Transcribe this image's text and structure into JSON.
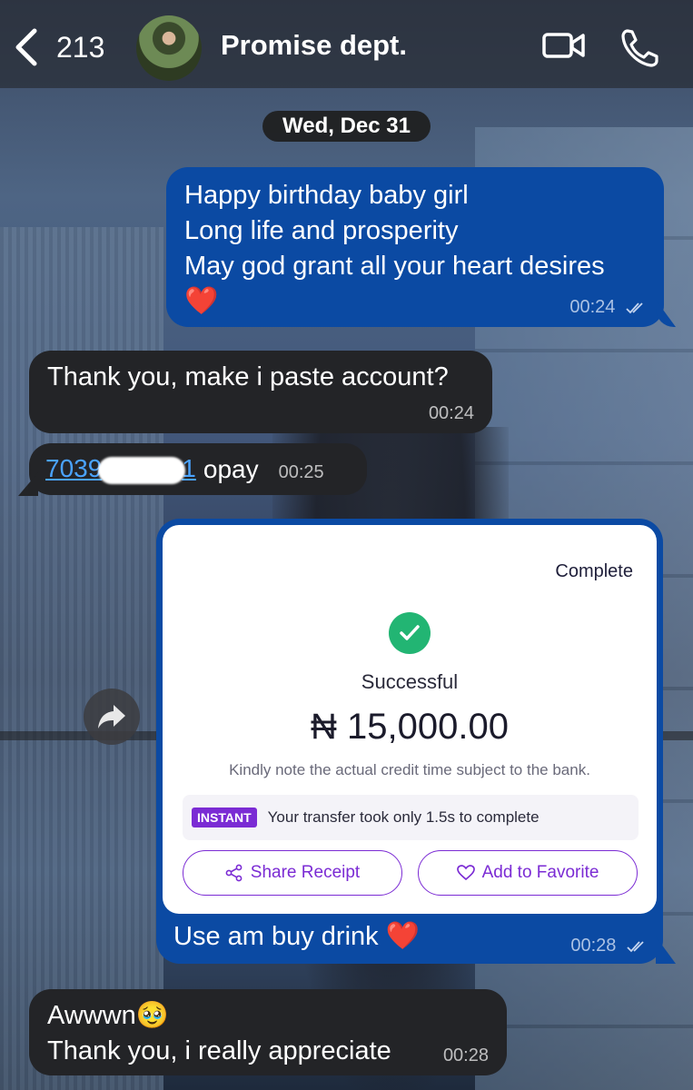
{
  "header": {
    "back_count": "213",
    "contact_name": "Promise dept."
  },
  "date_separator": "Wed, Dec 31",
  "messages": [
    {
      "direction": "outgoing",
      "lines": [
        "Happy birthday baby girl",
        "Long life and prosperity",
        "May god grant all your heart desires"
      ],
      "emoji": "heart",
      "time": "00:24"
    },
    {
      "direction": "incoming",
      "text": "Thank you, make i paste account?",
      "time": "00:24"
    },
    {
      "direction": "incoming",
      "account_prefix": "7039",
      "account_suffix": "1",
      "text_after": "opay",
      "time": "00:25"
    },
    {
      "direction": "outgoing",
      "caption": "Use am buy drink",
      "emoji": "heart",
      "time": "00:28"
    },
    {
      "direction": "incoming",
      "lines": [
        "Awwwn🥹",
        "Thank you, i really appreciate"
      ],
      "time": "00:28"
    }
  ],
  "receipt": {
    "status_label": "Complete",
    "result": "Successful",
    "amount": "₦ 15,000.00",
    "note": "Kindly note the actual credit time subject to the bank.",
    "badge": "INSTANT",
    "instant_text": "Your transfer took only 1.5s to complete",
    "share_label": "Share Receipt",
    "favorite_label": "Add to Favorite",
    "accent": "#7b2bd4",
    "success_color": "#22b573"
  },
  "colors": {
    "outgoing_bubble": "#0b4aa3",
    "incoming_bubble": "#232427",
    "link": "#4aa3ff"
  }
}
